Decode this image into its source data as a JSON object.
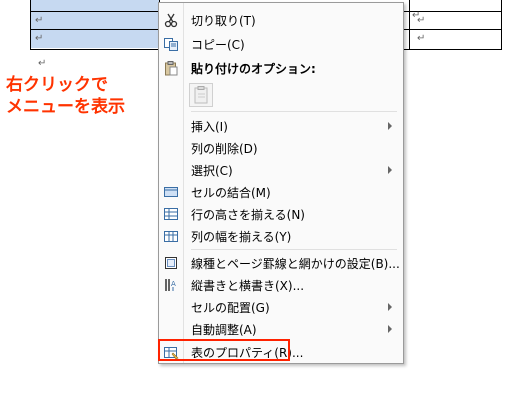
{
  "annotation": {
    "line1": "右クリックで",
    "line2": "メニューを表示"
  },
  "document": {
    "cell_mark": "↵",
    "paragraph_mark": "↵"
  },
  "context_menu": {
    "items": [
      {
        "label": "切り取り(T)",
        "icon": "scissors-icon",
        "submenu": false
      },
      {
        "label": "コピー(C)",
        "icon": "copy-icon",
        "submenu": false
      },
      {
        "label": "貼り付けのオプション:",
        "icon": "paste-icon",
        "submenu": false,
        "bold": true
      },
      {
        "label": "挿入(I)",
        "icon": "",
        "submenu": true
      },
      {
        "label": "列の削除(D)",
        "icon": "",
        "submenu": false
      },
      {
        "label": "選択(C)",
        "icon": "",
        "submenu": true
      },
      {
        "label": "セルの結合(M)",
        "icon": "merge-cells-icon",
        "submenu": false
      },
      {
        "label": "行の高さを揃える(N)",
        "icon": "distribute-rows-icon",
        "submenu": false
      },
      {
        "label": "列の幅を揃える(Y)",
        "icon": "distribute-columns-icon",
        "submenu": false
      },
      {
        "label": "線種とページ罫線と網かけの設定(B)...",
        "icon": "borders-icon",
        "submenu": false
      },
      {
        "label": "縦書きと横書き(X)...",
        "icon": "text-direction-icon",
        "submenu": false
      },
      {
        "label": "セルの配置(G)",
        "icon": "",
        "submenu": true
      },
      {
        "label": "自動調整(A)",
        "icon": "",
        "submenu": true
      },
      {
        "label": "表のプロパティ(R)...",
        "icon": "table-properties-icon",
        "submenu": false
      }
    ]
  },
  "colors": {
    "selection": "#c6d9f1",
    "annotation": "#ff3300",
    "highlight_border": "#ff2200"
  }
}
